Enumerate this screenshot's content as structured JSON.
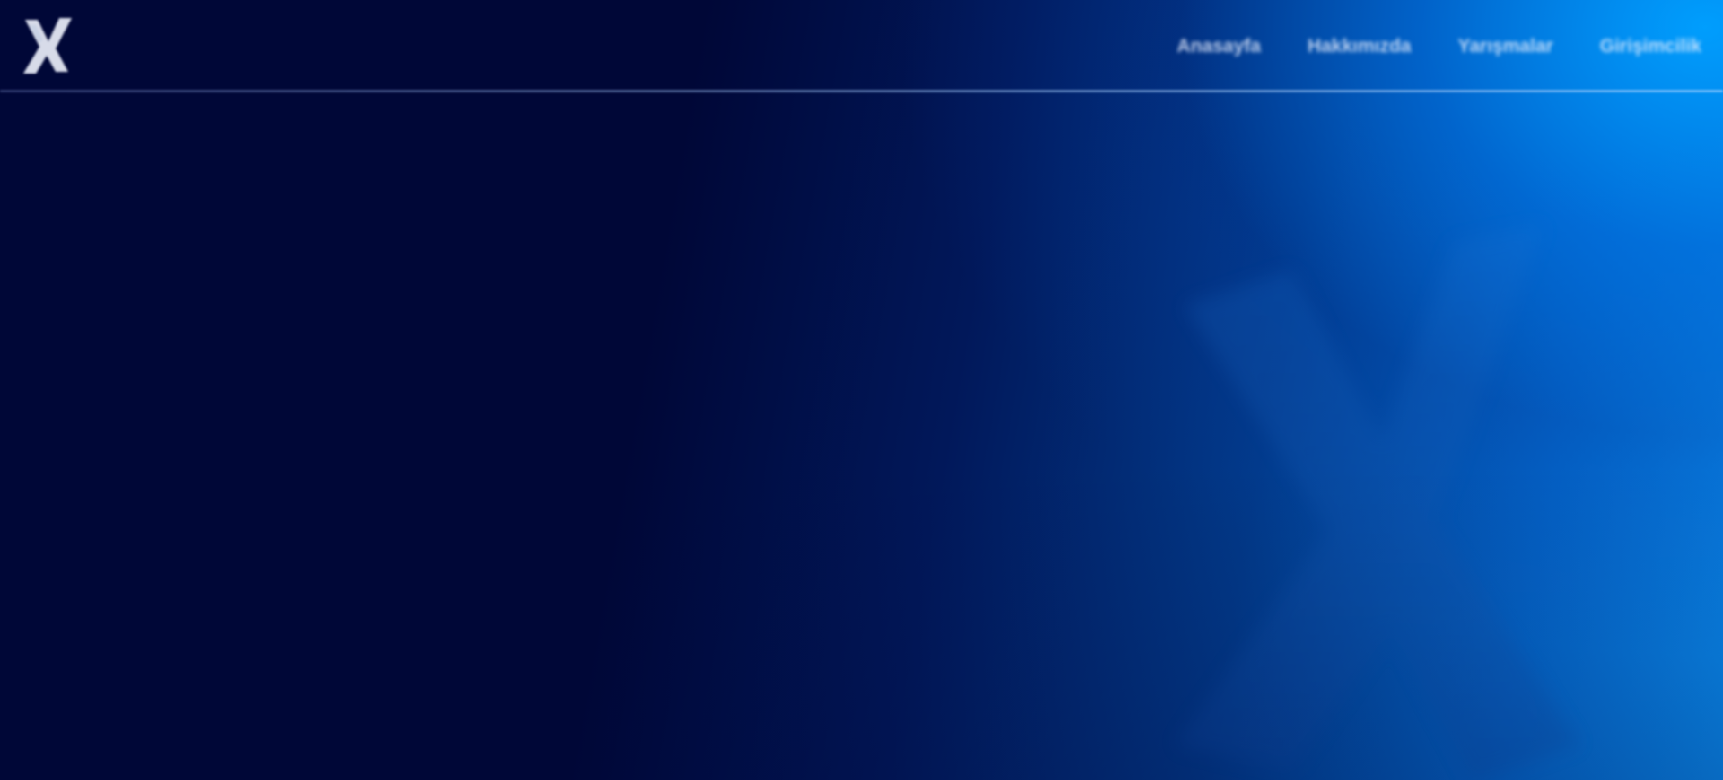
{
  "header": {
    "logo_icon": "x-brand-logo-icon",
    "nav": [
      {
        "label": "Anasayfa"
      },
      {
        "label": "Hakkımızda"
      },
      {
        "label": "Yarışmalar"
      },
      {
        "label": "Girişimcilik"
      }
    ]
  },
  "hero": {
    "watermark_icon": "x-watermark-icon"
  },
  "colors": {
    "background_dark": "#000737",
    "background_light": "#0a8cf0",
    "nav_text": "#e6eeff"
  }
}
